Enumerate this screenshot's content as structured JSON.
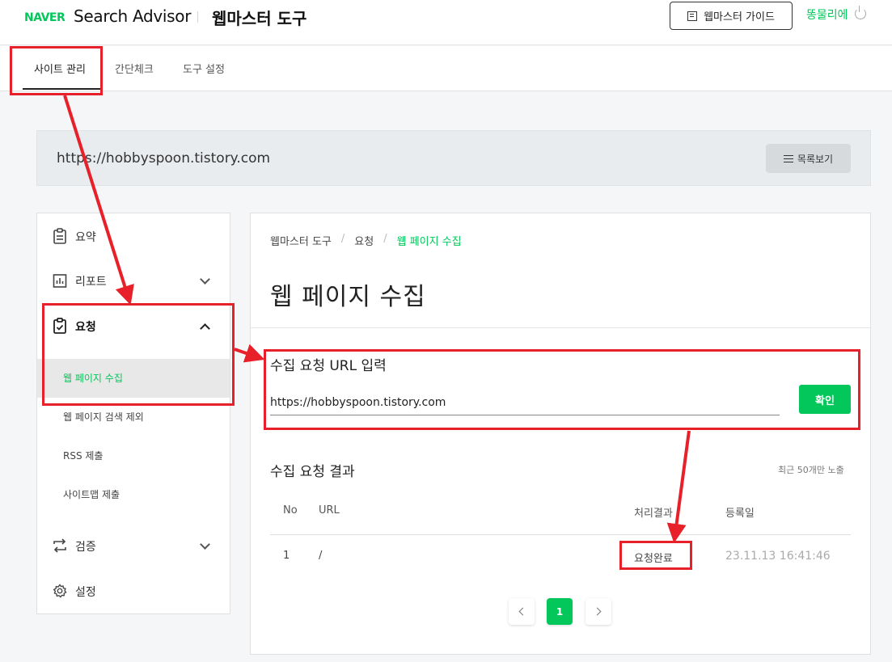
{
  "header": {
    "logo": "NAVER",
    "product": "Search Advisor",
    "tool_title": "웹마스터 도구",
    "guide_label": "웹마스터 가이드",
    "user_name": "똥물리에"
  },
  "tabs": [
    {
      "label": "사이트 관리",
      "active": true
    },
    {
      "label": "간단체크"
    },
    {
      "label": "도구 설정"
    }
  ],
  "site": {
    "url": "https://hobbyspoon.tistory.com",
    "list_label": "목록보기"
  },
  "sidebar": {
    "summary": "요약",
    "report": "리포트",
    "request": "요청",
    "sub_items": [
      "웹 페이지 수집",
      "웹 페이지 검색 제외",
      "RSS 제출",
      "사이트맵 제출"
    ],
    "verify": "검증",
    "settings": "설정"
  },
  "main": {
    "breadcrumb": [
      "웹마스터 도구",
      "요청",
      "웹 페이지 수집"
    ],
    "title": "웹 페이지 수집",
    "form_title": "수집 요청 URL 입력",
    "input_value": "https://hobbyspoon.tistory.com",
    "confirm_label": "확인",
    "result_title": "수집 요청 결과",
    "result_note": "최근 50개만 노출",
    "columns": {
      "no": "No",
      "url": "URL",
      "status": "처리결과",
      "date": "등록일"
    },
    "rows": [
      {
        "no": "1",
        "url": "/",
        "status": "요청완료",
        "date": "23.11.13 16:41:46"
      }
    ],
    "page": "1"
  },
  "colors": {
    "accent": "#03c75a",
    "annotation": "#e8202a"
  }
}
